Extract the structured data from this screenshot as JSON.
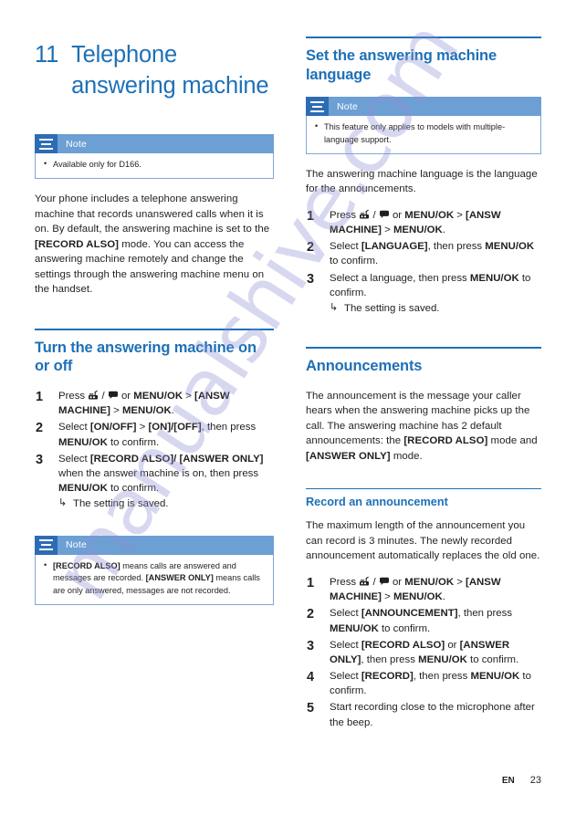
{
  "chapter": {
    "number": "11",
    "title": "Telephone answering machine"
  },
  "colors": {
    "heading_blue": "#1d70b7",
    "note_header_blue": "#6c9fd4",
    "note_icon_blue": "#2d6cb5",
    "note_border_blue": "#7fa8d6",
    "body_text": "#231f20",
    "watermark": "#8d8fd6"
  },
  "watermark": {
    "text": "manualshive.com"
  },
  "left_column": {
    "intro_note": {
      "label": "Note",
      "items": [
        "Available only for D166."
      ]
    },
    "intro_paragraph": {
      "part1": "Your phone includes a telephone answering machine that records unanswered calls when it is on. By default, the answering machine is set to the ",
      "bold1": "[RECORD ALSO]",
      "part2": " mode. You can access the answering machine remotely and change the settings through the answering machine menu on the handset."
    },
    "section": {
      "heading": "Turn the answering machine on or off",
      "steps": [
        {
          "pre": "Press ",
          "icon1": "answering-machine-icon",
          "mid": " / ",
          "icon2": "message-icon",
          "post_normal1": " or ",
          "post_bold1": "MENU/OK",
          "post_normal2": " > ",
          "post_bold2": "[ANSW MACHINE]",
          "post_normal3": " > ",
          "post_bold3": "MENU/OK",
          "post_normal4": "."
        },
        {
          "n1": "Select ",
          "b1": "[ON/OFF]",
          "n2": " > ",
          "b2": "[ON]/[OFF]",
          "n3": ", then press ",
          "b3": "MENU/OK",
          "n4": " to confirm."
        },
        {
          "n1": "Select ",
          "b1": "[RECORD ALSO]/ [ANSWER ONLY]",
          "n2": " when the answer machine is on, then press ",
          "b2": "MENU/OK",
          "n3": " to confirm.",
          "substep": "The setting is saved."
        }
      ]
    },
    "section_note": {
      "label": "Note",
      "item": {
        "b1": "[RECORD ALSO]",
        "n1": " means calls are answered and messages are recorded. ",
        "b2": "[ANSWER ONLY]",
        "n2": " means calls are only answered, messages are not recorded."
      }
    }
  },
  "right_column": {
    "section_language": {
      "heading": "Set the answering machine language",
      "note": {
        "label": "Note",
        "items": [
          "This feature only applies to models with multiple-language support."
        ]
      },
      "paragraph": "The answering machine language is the language for the announcements.",
      "steps": [
        {
          "pre": "Press ",
          "icon1": "answering-machine-icon",
          "mid": " / ",
          "icon2": "message-icon",
          "post_normal1": " or ",
          "post_bold1": "MENU/OK",
          "post_normal2": " > ",
          "post_bold2": "[ANSW MACHINE]",
          "post_normal3": " > ",
          "post_bold3": "MENU/OK",
          "post_normal4": "."
        },
        {
          "n1": "Select ",
          "b1": "[LANGUAGE]",
          "n2": ", then press ",
          "b2": "MENU/OK",
          "n3": " to confirm."
        },
        {
          "n1": "Select a language, then press ",
          "b1": "MENU/OK",
          "n2": " to confirm.",
          "substep": "The setting is saved."
        }
      ]
    },
    "section_announcements": {
      "heading": "Announcements",
      "paragraph": {
        "n1": "The announcement is the message your caller hears when the answering machine picks up the call. The answering machine has 2 default announcements: the ",
        "b1": "[RECORD ALSO]",
        "n2": " mode and ",
        "b2": "[ANSWER ONLY]",
        "n3": " mode."
      }
    },
    "subsection_record": {
      "heading": "Record an announcement",
      "paragraph": "The maximum length of the announcement you can record is 3 minutes. The newly recorded announcement automatically replaces the old one.",
      "steps": [
        {
          "pre": "Press ",
          "icon1": "answering-machine-icon",
          "mid": " / ",
          "icon2": "message-icon",
          "post_normal1": " or ",
          "post_bold1": "MENU/OK",
          "post_normal2": " > ",
          "post_bold2": "[ANSW MACHINE]",
          "post_normal3": " > ",
          "post_bold3": "MENU/OK",
          "post_normal4": "."
        },
        {
          "n1": "Select ",
          "b1": "[ANNOUNCEMENT]",
          "n2": ", then press ",
          "b2": "MENU/OK",
          "n3": " to confirm."
        },
        {
          "n1": "Select ",
          "b1": "[RECORD ALSO]",
          "n2": " or ",
          "b2": "[ANSWER ONLY]",
          "n3": ", then press ",
          "b3": "MENU/OK",
          "n4": " to confirm."
        },
        {
          "n1": "Select ",
          "b1": "[RECORD]",
          "n2": ", then press ",
          "b2": "MENU/OK",
          "n3": " to confirm."
        },
        {
          "n1": "Start recording close to the microphone after the beep."
        }
      ]
    }
  },
  "footer": {
    "language": "EN",
    "page_number": "23"
  }
}
